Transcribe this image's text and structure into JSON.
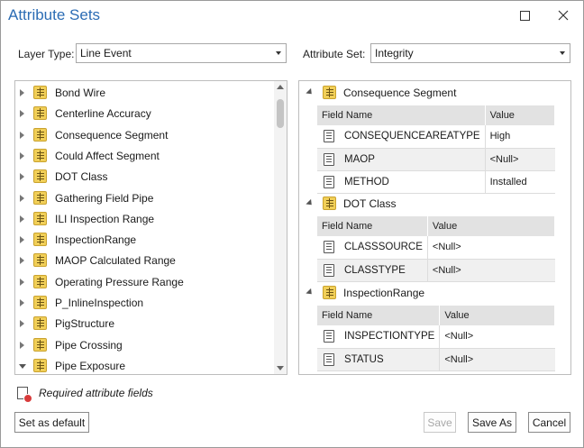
{
  "window": {
    "title": "Attribute Sets"
  },
  "layer_type": {
    "label": "Layer Type:",
    "value": "Line Event"
  },
  "attribute_set": {
    "label": "Attribute Set:",
    "value": "Integrity"
  },
  "left_list": {
    "items": [
      {
        "label": "Bond Wire",
        "expanded": false
      },
      {
        "label": "Centerline Accuracy",
        "expanded": false
      },
      {
        "label": "Consequence Segment",
        "expanded": false
      },
      {
        "label": "Could Affect Segment",
        "expanded": false
      },
      {
        "label": "DOT Class",
        "expanded": false
      },
      {
        "label": "Gathering Field Pipe",
        "expanded": false
      },
      {
        "label": "ILI Inspection Range",
        "expanded": false
      },
      {
        "label": "InspectionRange",
        "expanded": false
      },
      {
        "label": "MAOP Calculated Range",
        "expanded": false
      },
      {
        "label": "Operating Pressure Range",
        "expanded": false
      },
      {
        "label": "P_InlineInspection",
        "expanded": false
      },
      {
        "label": "PigStructure",
        "expanded": false
      },
      {
        "label": "Pipe Crossing",
        "expanded": false
      },
      {
        "label": "Pipe Exposure",
        "expanded": true
      }
    ]
  },
  "right_tree": {
    "col_field": "Field Name",
    "col_value": "Value",
    "groups": [
      {
        "name": "Consequence Segment",
        "rows": [
          {
            "field": "CONSEQUENCEAREATYPE",
            "value": "High"
          },
          {
            "field": "MAOP",
            "value": "<Null>"
          },
          {
            "field": "METHOD",
            "value": "Installed"
          }
        ]
      },
      {
        "name": "DOT Class",
        "rows": [
          {
            "field": "CLASSSOURCE",
            "value": "<Null>"
          },
          {
            "field": "CLASSTYPE",
            "value": "<Null>"
          }
        ]
      },
      {
        "name": "InspectionRange",
        "rows": [
          {
            "field": "INSPECTIONTYPE",
            "value": "<Null>"
          },
          {
            "field": "STATUS",
            "value": "<Null>"
          }
        ]
      }
    ]
  },
  "legend": {
    "required_text": "Required attribute fields"
  },
  "buttons": {
    "set_default": "Set as default",
    "save": "Save",
    "save_as": "Save As",
    "cancel": "Cancel"
  }
}
